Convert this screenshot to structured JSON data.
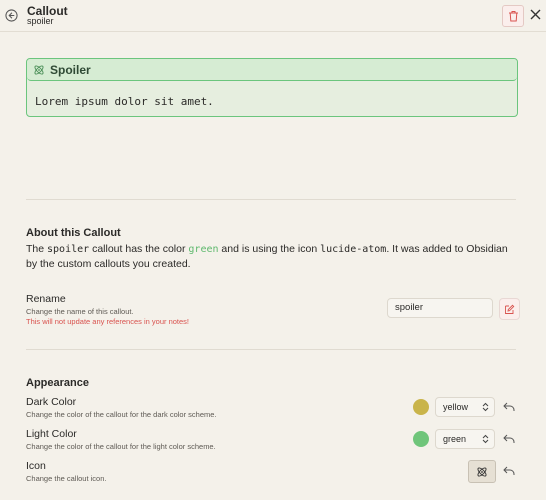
{
  "header": {
    "title": "Callout",
    "subtitle": "spoiler"
  },
  "preview": {
    "title": "Spoiler",
    "body": "Lorem ipsum dolor sit amet.",
    "icon": "atom-icon"
  },
  "about": {
    "heading": "About this Callout",
    "text_1": "The ",
    "callout_id": "spoiler",
    "text_2": " callout has the color ",
    "color_name": "green",
    "text_3": " and is using the icon ",
    "icon_name": "lucide-atom",
    "text_4": ". It was added to Obsidian by the custom callouts you created."
  },
  "rename": {
    "label": "Rename",
    "description": "Change the name of this callout.",
    "warning": "This will not update any references in your notes!",
    "value": "spoiler"
  },
  "appearance": {
    "heading": "Appearance",
    "dark_color": {
      "label": "Dark Color",
      "description": "Change the color of the callout for the dark color scheme.",
      "value": "yellow",
      "swatch": "#c9b44a"
    },
    "light_color": {
      "label": "Light Color",
      "description": "Change the color of the callout for the light color scheme.",
      "value": "green",
      "swatch": "#6fc57a"
    },
    "icon": {
      "label": "Icon",
      "description": "Change the callout icon."
    }
  },
  "colors": {
    "accent_green": "#6bc57d",
    "danger": "#d9534f",
    "background": "#f4f1ea"
  }
}
